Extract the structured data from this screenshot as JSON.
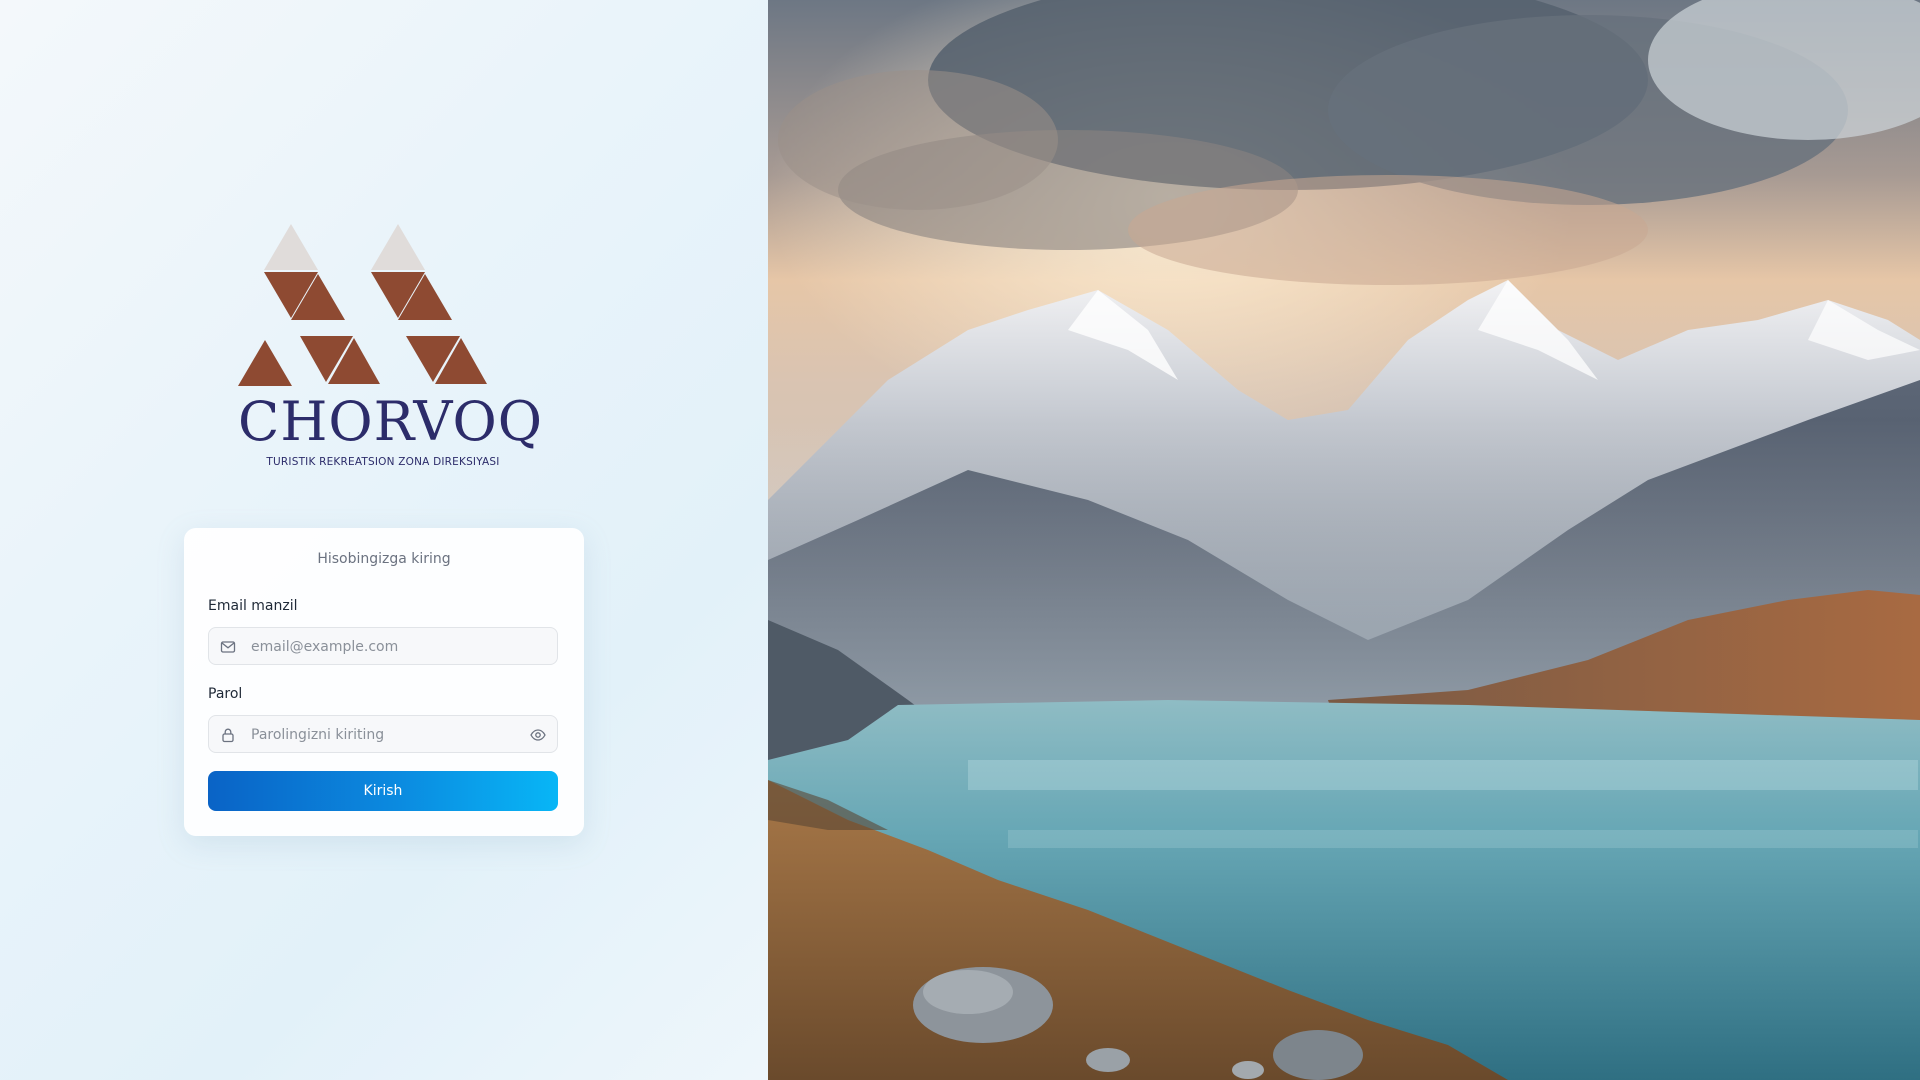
{
  "brand": {
    "name": "CHORVOQ",
    "subtitle": "TURISTIK REKREATSION ZONA DIREKSIYASI",
    "colors": {
      "triangle_brown": "#8e4a32",
      "triangle_light": "#e0dcda",
      "text_navy": "#2c2c6a"
    }
  },
  "login": {
    "subtitle": "Hisobingizga kiring",
    "email": {
      "label": "Email manzil",
      "placeholder": "email@example.com",
      "value": "",
      "icon": "mail-icon"
    },
    "password": {
      "label": "Parol",
      "placeholder": "Parolingizni kiriting",
      "value": "",
      "icon": "lock-icon",
      "toggle_icon": "eye-icon"
    },
    "submit_label": "Kirish",
    "button_colors": [
      "#0a63c6",
      "#08b6f6"
    ]
  },
  "hero_image": {
    "description_icon": "mountain-lake-landscape"
  }
}
